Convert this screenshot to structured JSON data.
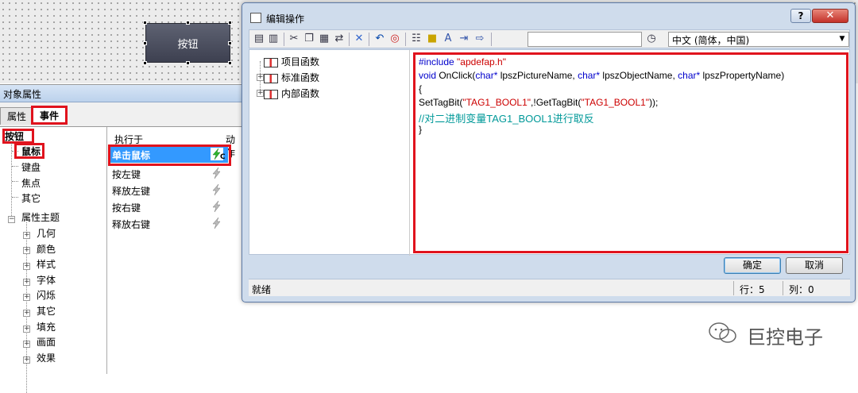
{
  "canvas": {
    "button_label": "按钮"
  },
  "props": {
    "title": "对象属性",
    "tabs": [
      {
        "label": "属性"
      },
      {
        "label": "事件"
      }
    ],
    "tree": {
      "root": "按钮",
      "items": [
        "鼠标",
        "键盘",
        "焦点",
        "其它"
      ],
      "group": "属性主题",
      "group_items": [
        "几何",
        "颜色",
        "样式",
        "字体",
        "闪烁",
        "其它",
        "填充",
        "画面",
        "效果"
      ]
    },
    "grid": {
      "col_exec": "执行于",
      "col_action": "动作",
      "rows": [
        "单击鼠标",
        "按左键",
        "释放左键",
        "按右键",
        "释放右键"
      ],
      "selected_badge": "C"
    }
  },
  "dialog": {
    "title": "编辑操作",
    "help": "?",
    "close": "✕",
    "language": "中文 (简体，中国)",
    "func_tree": [
      "项目函数",
      "标准函数",
      "内部函数"
    ],
    "code": {
      "l1_pre": "#include ",
      "l1_str": "\"apdefap.h\"",
      "l2_kw1": "void",
      "l2_a": " OnClick(",
      "l2_kw2": "char*",
      "l2_b": " lpszPictureName, ",
      "l2_kw3": "char*",
      "l2_c": " lpszObjectName, ",
      "l2_kw4": "char*",
      "l2_d": " lpszPropertyName)",
      "l3": "{",
      "l4_a": "SetTagBit(",
      "l4_s1": "\"TAG1_BOOL1\"",
      "l4_b": ",!GetTagBit(",
      "l4_s2": "\"TAG1_BOOL1\"",
      "l4_c": "));",
      "l5": "//对二进制变量TAG1_BOOL1进行取反",
      "l6": "}"
    },
    "ok": "确定",
    "cancel": "取消",
    "status": "就绪",
    "row": "行：5",
    "col": "列：0"
  },
  "watermark": "巨控电子"
}
